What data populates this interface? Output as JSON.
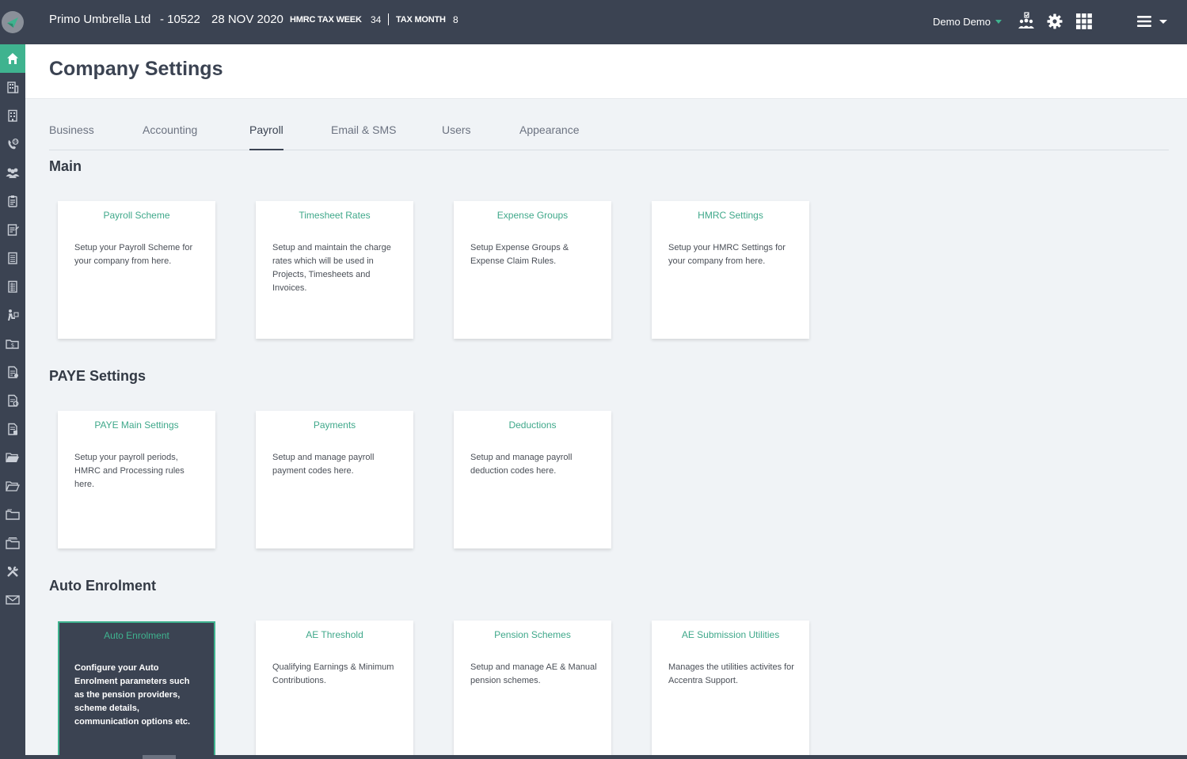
{
  "topbar": {
    "company_name": "Primo Umbrella Ltd",
    "company_id": "- 10522",
    "date": "28 NOV 2020",
    "tax_week_label": "HMRC TAX WEEK",
    "tax_week_value": "34",
    "tax_month_label": "TAX MONTH",
    "tax_month_value": "8",
    "user_name": "Demo Demo",
    "icons": [
      "team-tasks-icon",
      "gear-icon",
      "grid-icon",
      "hamburger-menu-icon"
    ]
  },
  "sidebar": {
    "items": [
      "home-icon",
      "building-icon",
      "office-icon",
      "phone-support-icon",
      "people-icon",
      "clipboard-icon",
      "form-icon",
      "document-icon",
      "ledger-icon",
      "worker-icon",
      "money-folder-icon",
      "invoice-icon",
      "report-icon",
      "statement-icon",
      "folder-open-icon",
      "folder-upload-icon",
      "folder-icon",
      "folder-stack-icon",
      "tools-icon",
      "mail-icon"
    ],
    "active_index": 0
  },
  "page": {
    "title": "Company Settings"
  },
  "tabs": [
    {
      "label": "Business"
    },
    {
      "label": "Accounting"
    },
    {
      "label": "Payroll"
    },
    {
      "label": "Email & SMS"
    },
    {
      "label": "Users"
    },
    {
      "label": "Appearance"
    }
  ],
  "active_tab": "Payroll",
  "sections": [
    {
      "title": "Main",
      "cards": [
        {
          "title": "Payroll Scheme",
          "desc": "Setup your Payroll Scheme for your company from here."
        },
        {
          "title": "Timesheet Rates",
          "desc": "Setup and maintain the charge rates which will be used in Projects, Timesheets and Invoices."
        },
        {
          "title": "Expense Groups",
          "desc": "Setup Expense Groups & Expense Claim Rules."
        },
        {
          "title": "HMRC Settings",
          "desc": "Setup your HMRC Settings for your company from here."
        }
      ]
    },
    {
      "title": "PAYE Settings",
      "cards": [
        {
          "title": "PAYE Main Settings",
          "desc": "Setup your payroll periods, HMRC and Processing rules here."
        },
        {
          "title": "Payments",
          "desc": "Setup and manage payroll payment codes here."
        },
        {
          "title": "Deductions",
          "desc": "Setup and manage payroll deduction codes here."
        }
      ]
    },
    {
      "title": "Auto Enrolment",
      "cards": [
        {
          "title": "Auto Enrolment",
          "desc": "Configure your Auto Enrolment parameters such as the pension providers, scheme details, communication options etc."
        },
        {
          "title": "AE Threshold",
          "desc": "Qualifying Earnings & Minimum Contributions."
        },
        {
          "title": "Pension Schemes",
          "desc": "Setup and manage AE & Manual pension schemes."
        },
        {
          "title": "AE Submission Utilities",
          "desc": "Manages the utilities activites for Accentra Support."
        }
      ]
    }
  ],
  "colors": {
    "bar": "#3b4352",
    "accent": "#3fb38f",
    "card_title": "#3fa88a",
    "background": "#f0f3f6"
  }
}
